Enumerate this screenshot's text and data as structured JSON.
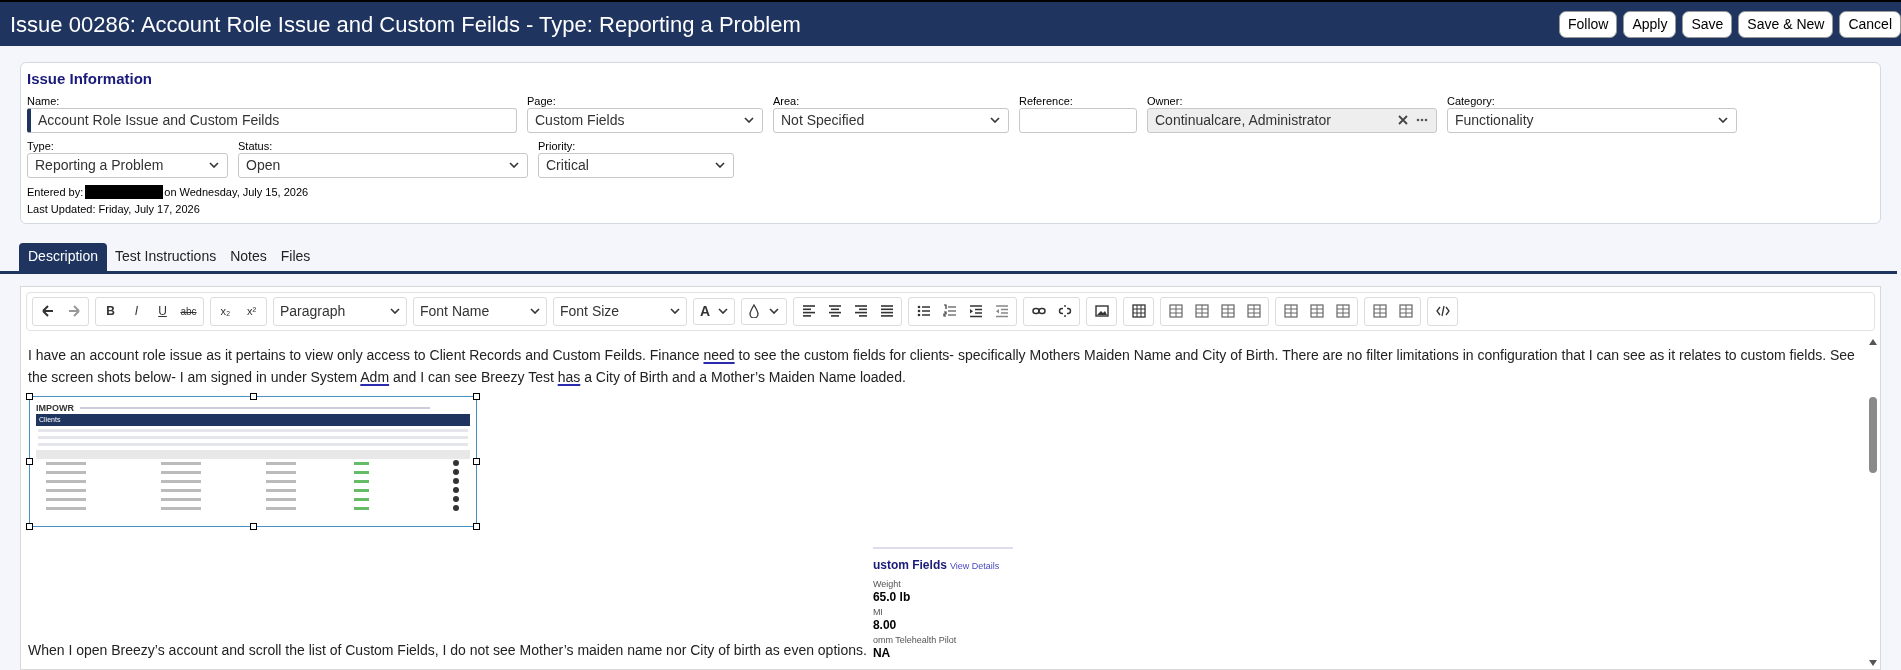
{
  "header": {
    "title": "Issue 00286: Account Role Issue and Custom Feilds - Type: Reporting a Problem",
    "buttons": [
      "Follow",
      "Apply",
      "Save",
      "Save & New",
      "Cancel"
    ]
  },
  "issue_information": {
    "heading": "Issue Information",
    "fields": [
      {
        "label": "Name:",
        "value": "Account Role Issue and Custom Feilds",
        "kind": "text",
        "required": true
      },
      {
        "label": "Page:",
        "value": "Custom Fields",
        "kind": "select",
        "required": false
      },
      {
        "label": "Area:",
        "value": "Not Specified",
        "kind": "select",
        "required": false
      },
      {
        "label": "Reference:",
        "kind": "text",
        "required": false
      },
      {
        "label": "Owner:",
        "value": "Continualcare, Administrator",
        "kind": "lookup",
        "required": false
      },
      {
        "label": "Category:",
        "value": "Functionality",
        "kind": "select",
        "required": false
      },
      {
        "label": "Type:",
        "value": "Reporting a Problem",
        "kind": "select",
        "required": false
      },
      {
        "label": "Status:",
        "value": "Open",
        "kind": "select",
        "required": false
      },
      {
        "label": "Priority:",
        "value": "Critical",
        "kind": "select",
        "required": false
      }
    ],
    "entered_by": {
      "label": "Entered by:",
      "date": "on Wednesday, July 15, 2026",
      "redacted": true
    },
    "last_updated": "Last Updated: Friday, July 17, 2026"
  },
  "tabs": [
    {
      "label": "Description",
      "selected": true
    },
    {
      "label": "Test Instructions",
      "selected": false
    },
    {
      "label": "Notes",
      "selected": false
    },
    {
      "label": "Files",
      "selected": false
    }
  ],
  "toolbar": {
    "bold": "B",
    "italic": "I",
    "underline": "U",
    "strikethrough": "abc",
    "subscript": "x₂",
    "superscript": "x²",
    "dropdowns": [
      "Paragraph",
      "Font Name",
      "Font Size"
    ],
    "text_color": "A"
  },
  "content": {
    "paragraph": [
      {
        "text": "I have an account role issue as it pertains to view only access to Client Records and Custom Feilds. Finance ",
        "underlined": false
      },
      {
        "text": "need",
        "underlined": true
      },
      {
        "text": " to see the custom fields for clients- specifically Mothers Maiden Name and City of Birth. There are no filter limitations in configuration that I can see as it relates to custom fields. See the screen shots below- I am signed in under System ",
        "underlined": false
      },
      {
        "text": "Adm",
        "underlined": true
      },
      {
        "text": " and I can see Breezy Test ",
        "underlined": false
      },
      {
        "text": "has",
        "underlined": true
      },
      {
        "text": " a City of Birth and a Mother’s Maiden Name loaded.",
        "underlined": false
      }
    ],
    "screenshot": {
      "logo": "IMPOWR",
      "heading": "Clients",
      "selected": true
    },
    "closing": "When I open Breezy’s account and scroll the list of Custom Fields, I do not see Mother’s maiden name nor City of birth as even options.",
    "custom_fields_card": {
      "title": "ustom Fields",
      "link": "View Details",
      "items": [
        {
          "label": "Weight",
          "value": "65.0 lb"
        },
        {
          "label": "MI",
          "value": "8.00"
        },
        {
          "label": "omm Telehealth Pilot",
          "value": "NA"
        }
      ]
    }
  }
}
